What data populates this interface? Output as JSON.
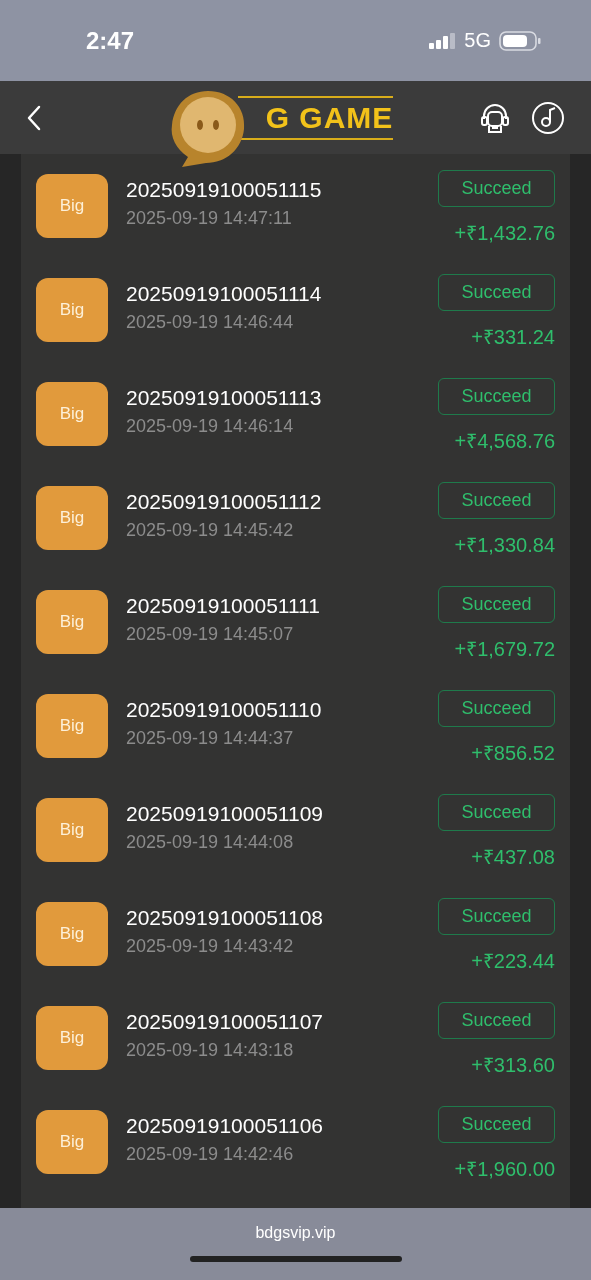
{
  "status_bar": {
    "time": "2:47",
    "network": "5G"
  },
  "header": {
    "logo_text": "G GAME"
  },
  "records": [
    {
      "type": "Big",
      "order": "20250919100051115",
      "time": "2025-09-19 14:47:11",
      "status": "Succeed",
      "amount": "+₹1,432.76"
    },
    {
      "type": "Big",
      "order": "20250919100051114",
      "time": "2025-09-19 14:46:44",
      "status": "Succeed",
      "amount": "+₹331.24"
    },
    {
      "type": "Big",
      "order": "20250919100051113",
      "time": "2025-09-19 14:46:14",
      "status": "Succeed",
      "amount": "+₹4,568.76"
    },
    {
      "type": "Big",
      "order": "20250919100051112",
      "time": "2025-09-19 14:45:42",
      "status": "Succeed",
      "amount": "+₹1,330.84"
    },
    {
      "type": "Big",
      "order": "20250919100051111",
      "time": "2025-09-19 14:45:07",
      "status": "Succeed",
      "amount": "+₹1,679.72"
    },
    {
      "type": "Big",
      "order": "20250919100051110",
      "time": "2025-09-19 14:44:37",
      "status": "Succeed",
      "amount": "+₹856.52"
    },
    {
      "type": "Big",
      "order": "20250919100051109",
      "time": "2025-09-19 14:44:08",
      "status": "Succeed",
      "amount": "+₹437.08"
    },
    {
      "type": "Big",
      "order": "20250919100051108",
      "time": "2025-09-19 14:43:42",
      "status": "Succeed",
      "amount": "+₹223.44"
    },
    {
      "type": "Big",
      "order": "20250919100051107",
      "time": "2025-09-19 14:43:18",
      "status": "Succeed",
      "amount": "+₹313.60"
    },
    {
      "type": "Big",
      "order": "20250919100051106",
      "time": "2025-09-19 14:42:46",
      "status": "Succeed",
      "amount": "+₹1,960.00"
    }
  ],
  "browser_bar": {
    "url": "bdgsvip.vip"
  }
}
